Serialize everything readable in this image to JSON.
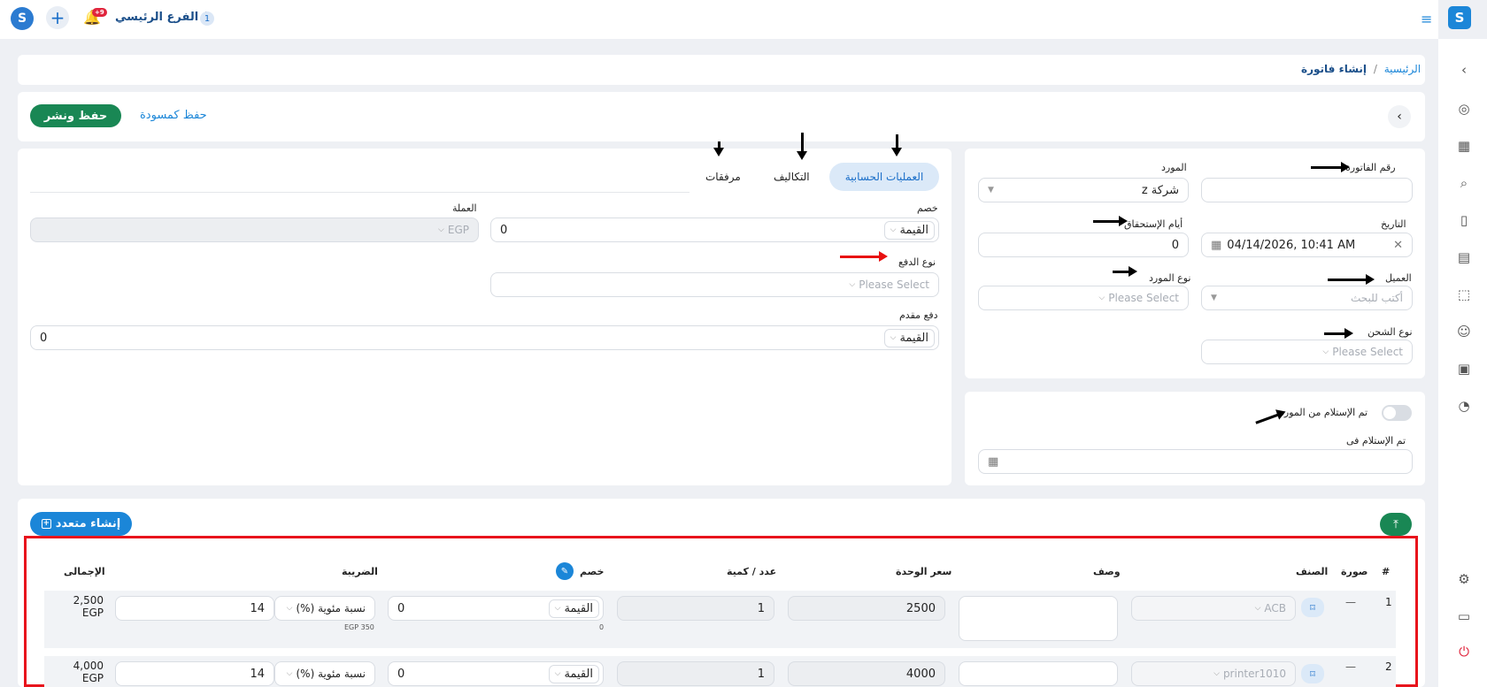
{
  "topbar": {
    "branch_count": "1",
    "branch_name": "الفرع الرئيسي /",
    "notification_count": "+9",
    "logo_letter": "S"
  },
  "breadcrumb": {
    "home": "الرئيسية",
    "sep": "/",
    "current": "إنشاء فاتورة"
  },
  "actions": {
    "save_publish": "حفظ ونشر",
    "save_draft": "حفظ كمسودة"
  },
  "invoice": {
    "invoice_number_label": "رقم الفاتورة",
    "supplier_label": "المورد",
    "supplier_value": "شركة z",
    "date_label": "التاريخ",
    "date_value": "04/14/2026, 10:41 AM",
    "due_days_label": "أيام الإستحقاق",
    "due_days_value": "0",
    "client_label": "العميل",
    "client_placeholder": "أكتب للبحث",
    "supplier_type_label": "نوع المورد",
    "supplier_type_placeholder": "Please Select",
    "shipping_type_label": "نوع الشحن",
    "shipping_type_placeholder": "Please Select",
    "received_label": "تم الإستلام من المورد",
    "received_at_label": "تم الإستلام فى"
  },
  "tabs": {
    "accounting": "العمليات الحسابية",
    "costs": "التكاليف",
    "attachments": "مرفقات"
  },
  "accounting": {
    "discount_label": "خصم",
    "discount_type": "القيمة",
    "discount_value": "0",
    "currency_label": "العملة",
    "currency_value": "EGP",
    "payment_type_label": "نوع الدفع",
    "payment_type_placeholder": "Please Select",
    "advance_label": "دفع مقدم",
    "advance_type": "القيمة",
    "advance_value": "0"
  },
  "items": {
    "create_multiple": "إنشاء متعدد",
    "headers": {
      "num": "#",
      "image": "صورة",
      "item": "الصنف",
      "description": "وصف",
      "unit_price": "سعر الوحدة",
      "quantity": "عدد / كمية",
      "discount": "خصم",
      "tax": "الضريبة",
      "total": "الإجمالى"
    },
    "rows": [
      {
        "num": "1",
        "image": "—",
        "item": "ACB",
        "unit_price": "2500",
        "quantity": "1",
        "discount_type": "القيمة",
        "discount_value": "0",
        "discount_note": "0",
        "tax_type": "نسبة مئوية (%)",
        "tax_value": "14",
        "tax_note": "EGP 350",
        "total": "2,500",
        "currency": "EGP"
      },
      {
        "num": "2",
        "image": "—",
        "item": "printer1010",
        "unit_price": "4000",
        "quantity": "1",
        "discount_type": "القيمة",
        "discount_value": "0",
        "tax_type": "نسبة مئوية (%)",
        "tax_value": "14",
        "total": "4,000",
        "currency": "EGP"
      }
    ]
  }
}
